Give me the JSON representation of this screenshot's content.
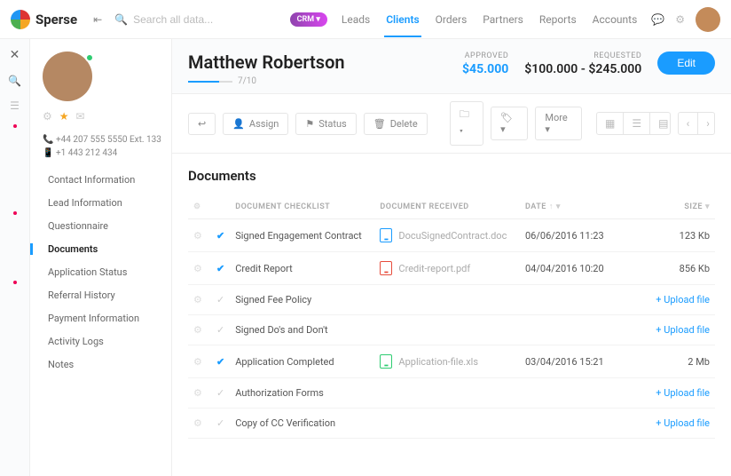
{
  "brand": {
    "name": "Sperse"
  },
  "search": {
    "placeholder": "Search all data..."
  },
  "nav": {
    "crm": "CRM ▾",
    "items": [
      "Leads",
      "Clients",
      "Orders",
      "Partners",
      "Reports",
      "Accounts"
    ],
    "active": "Clients"
  },
  "profile": {
    "name": "Matthew Robertson",
    "progress_text": "7/10",
    "phone1": "+44 207 555 5550 Ext. 133",
    "phone2": "+1 443 212 434"
  },
  "amounts": {
    "approved_label": "APPROVED",
    "approved_value": "$45.000",
    "requested_label": "REQUESTED",
    "requested_value": "$100.000 - $245.000",
    "edit_label": "Edit"
  },
  "sidenav": {
    "items": [
      "Contact Information",
      "Lead Information",
      "Questionnaire",
      "Documents",
      "Application Status",
      "Referral History",
      "Payment Information",
      "Activity Logs",
      "Notes"
    ],
    "active": "Documents"
  },
  "toolbar": {
    "assign": "Assign",
    "status": "Status",
    "delete": "Delete",
    "more": "More ▾"
  },
  "section_title": "Documents",
  "columns": {
    "checklist": "DOCUMENT CHECKLIST",
    "received": "DOCUMENT RECEIVED",
    "date": "DATE",
    "size": "SIZE"
  },
  "upload_label": "+ Upload file",
  "rows": [
    {
      "done": true,
      "name": "Signed Engagement Contract",
      "file": "DocuSignedContract.doc",
      "ftype": "blue",
      "date": "06/06/2016 11:23",
      "size": "123 Kb"
    },
    {
      "done": true,
      "name": "Credit Report",
      "file": "Credit-report.pdf",
      "ftype": "red",
      "date": "04/04/2016 10:20",
      "size": "856 Kb"
    },
    {
      "done": false,
      "name": "Signed Fee Policy",
      "file": "",
      "ftype": "",
      "date": "",
      "size": ""
    },
    {
      "done": false,
      "name": "Signed Do's and Don't",
      "file": "",
      "ftype": "",
      "date": "",
      "size": ""
    },
    {
      "done": true,
      "name": "Application Completed",
      "file": "Application-file.xls",
      "ftype": "green",
      "date": "03/04/2016 15:21",
      "size": "2 Mb"
    },
    {
      "done": false,
      "name": "Authorization Forms",
      "file": "",
      "ftype": "",
      "date": "",
      "size": ""
    },
    {
      "done": false,
      "name": "Copy of CC Verification",
      "file": "",
      "ftype": "",
      "date": "",
      "size": ""
    }
  ]
}
